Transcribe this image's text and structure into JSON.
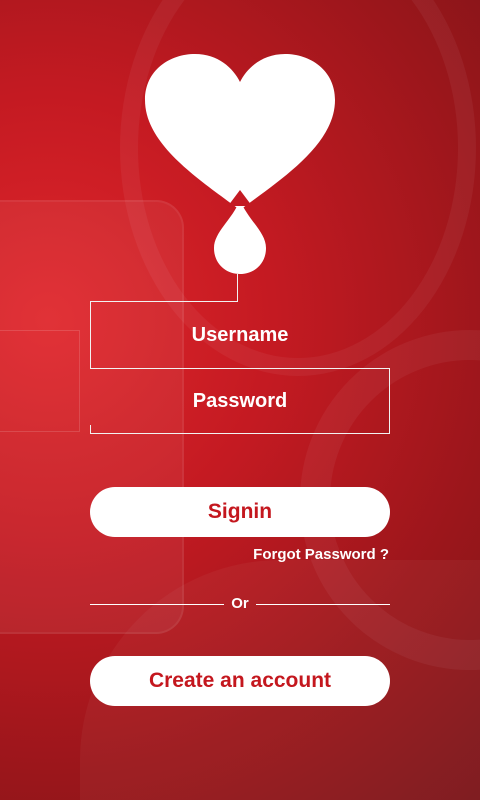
{
  "login": {
    "username_label": "Username",
    "password_label": "Password"
  },
  "actions": {
    "signin_label": "Signin",
    "forgot_label": "Forgot Password ?",
    "divider_label": "Or",
    "create_account_label": "Create an account"
  },
  "colors": {
    "background_primary": "#c41a22",
    "background_dark": "#7a1418",
    "button_background": "#ffffff",
    "button_text": "#c4171e",
    "text": "#ffffff"
  },
  "icons": {
    "logo": "heart-blood-drop-icon"
  }
}
